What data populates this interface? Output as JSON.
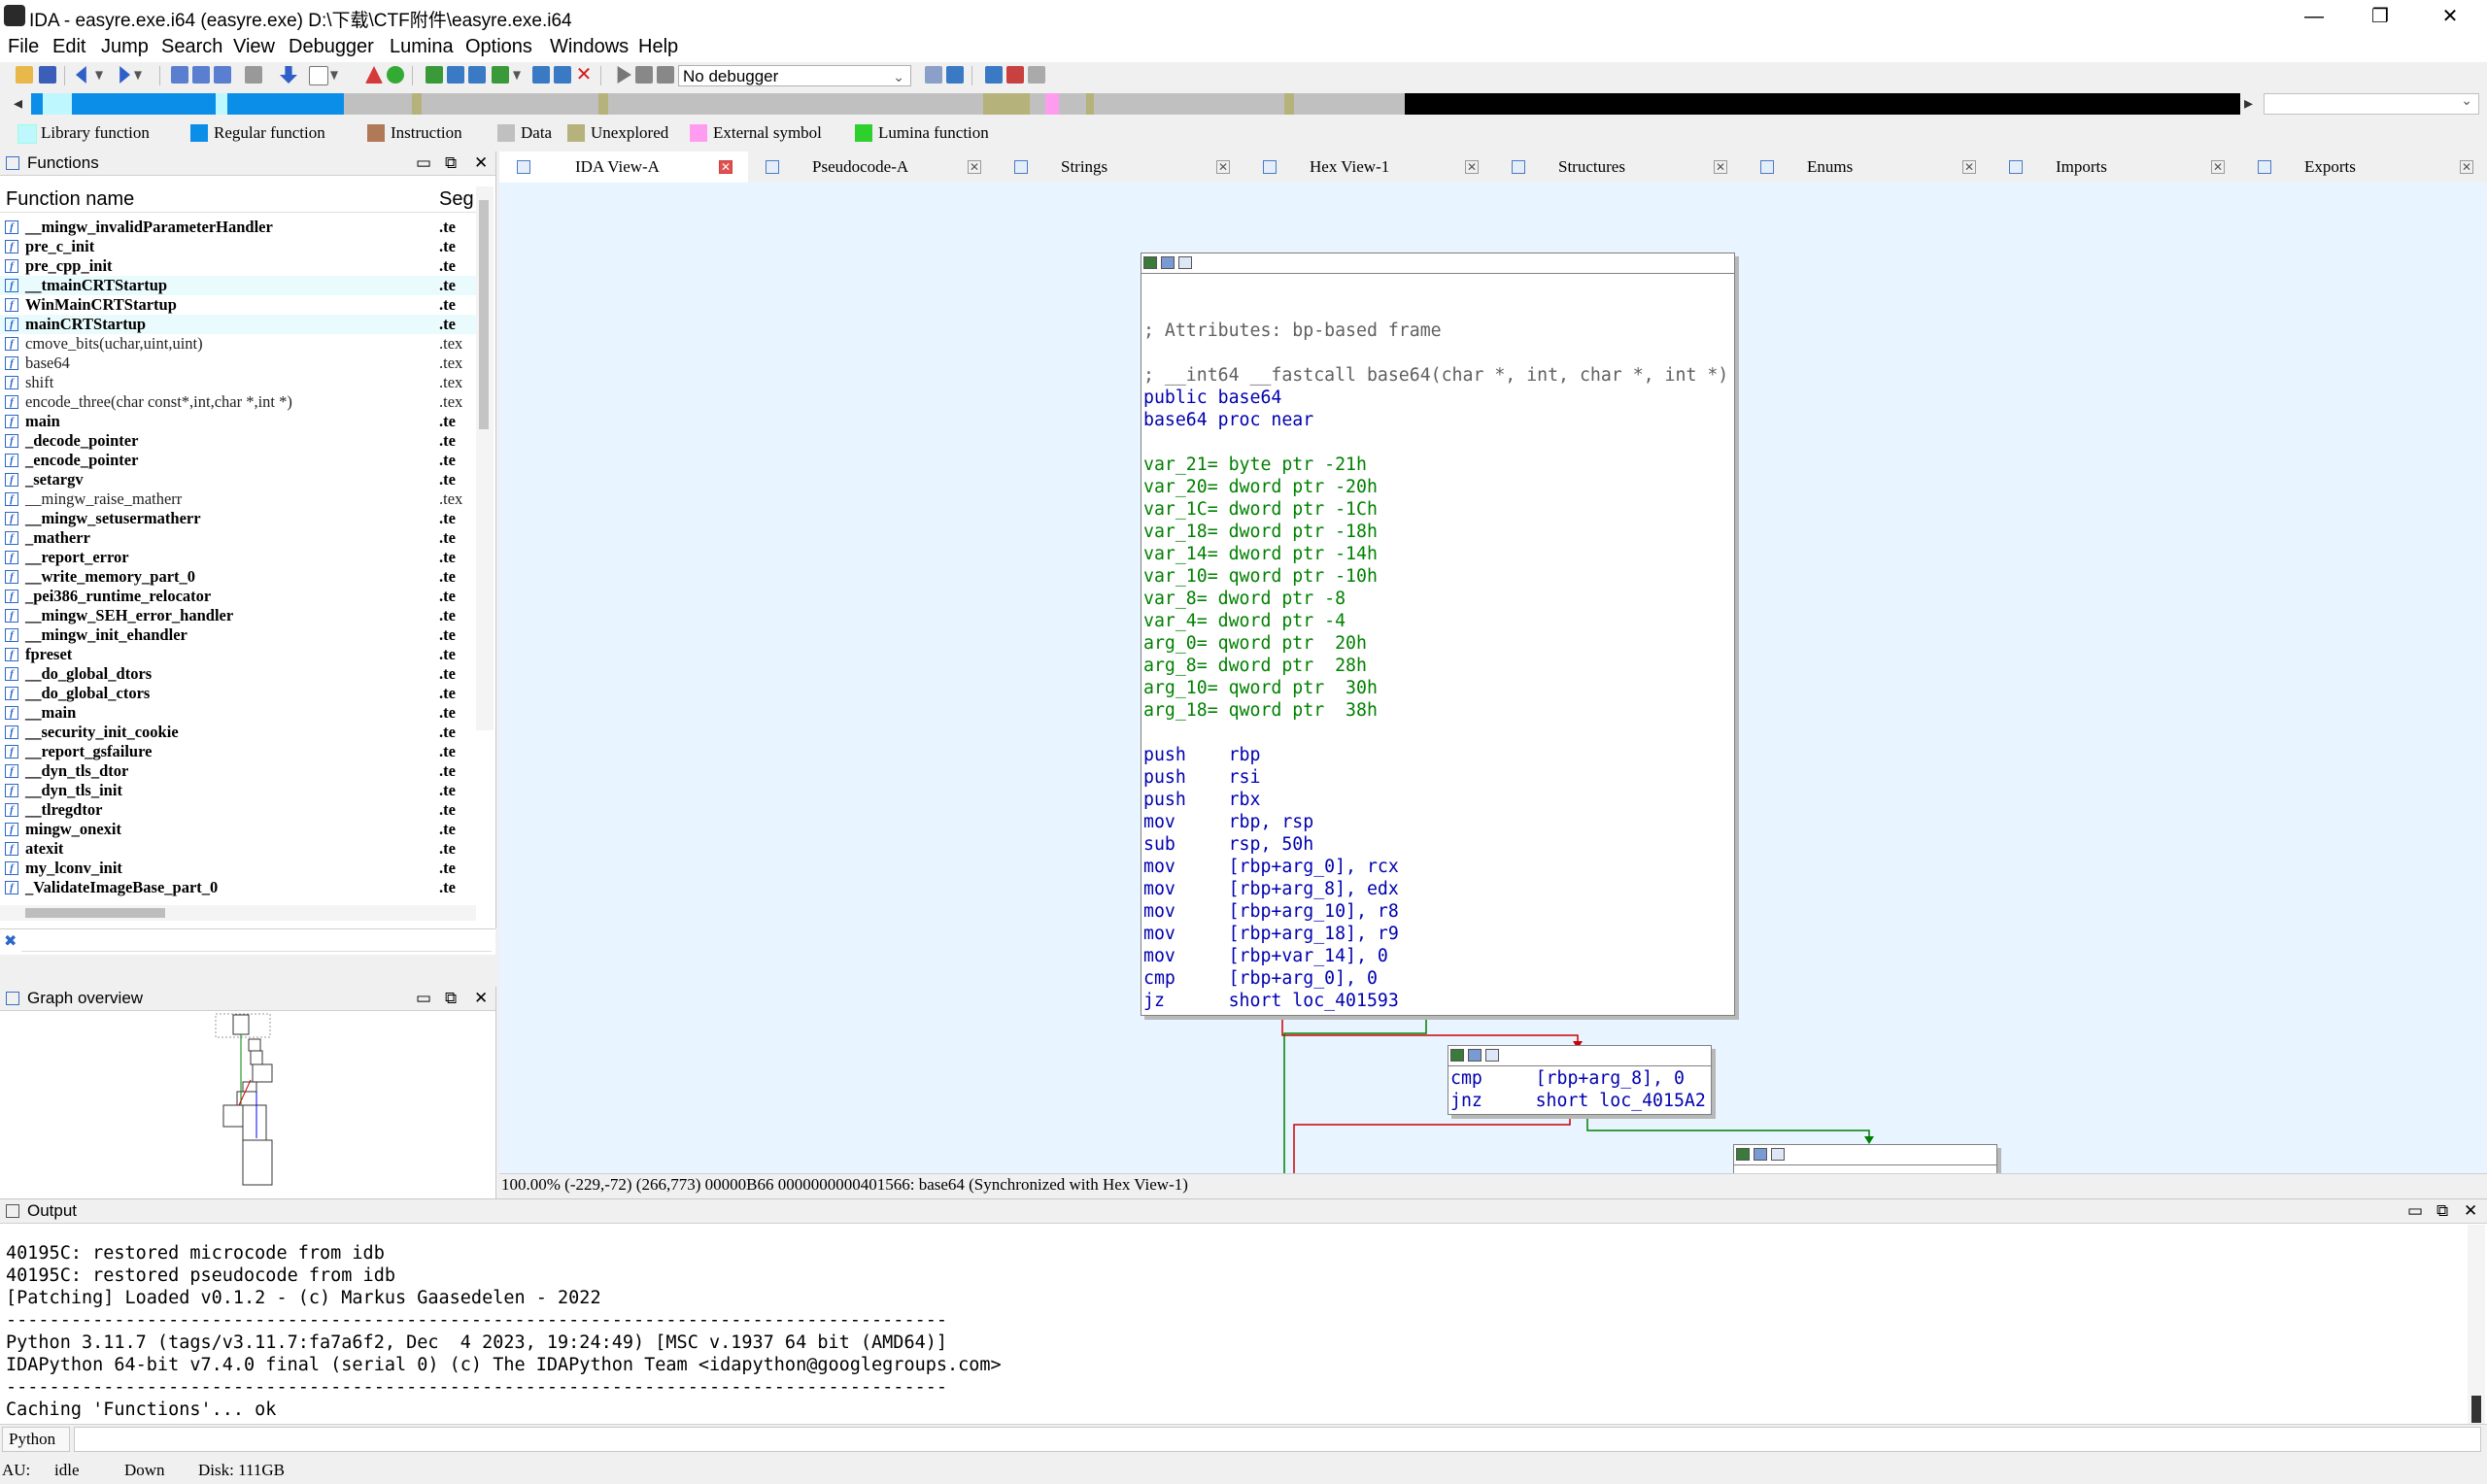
{
  "window": {
    "title": "IDA - easyre.exe.i64 (easyre.exe) D:\\下载\\CTF附件\\easyre.exe.i64",
    "minimize": "—",
    "maximize": "❐",
    "close": "✕"
  },
  "menu": [
    "File",
    "Edit",
    "Jump",
    "Search",
    "View",
    "Debugger",
    "Lumina",
    "Options",
    "Windows",
    "Help"
  ],
  "toolbar": {
    "debugger_select": "No debugger"
  },
  "legend": [
    {
      "label": "Library function",
      "color": "#bff7ff"
    },
    {
      "label": "Regular function",
      "color": "#0b8ee8"
    },
    {
      "label": "Instruction",
      "color": "#b07a58"
    },
    {
      "label": "Data",
      "color": "#c0c0c0"
    },
    {
      "label": "Unexplored",
      "color": "#b5b27c"
    },
    {
      "label": "External symbol",
      "color": "#ff9cf0"
    },
    {
      "label": "Lumina function",
      "color": "#2ed02e"
    }
  ],
  "functions_panel": {
    "title": "Functions",
    "col_name": "Function name",
    "col_seg": "Seg",
    "rows": [
      {
        "name": "__mingw_invalidParameterHandler",
        "seg": ".te",
        "bold": true
      },
      {
        "name": "pre_c_init",
        "seg": ".te",
        "bold": true
      },
      {
        "name": "pre_cpp_init",
        "seg": ".te",
        "bold": true
      },
      {
        "name": "__tmainCRTStartup",
        "seg": ".te",
        "bold": true
      },
      {
        "name": "WinMainCRTStartup",
        "seg": ".te",
        "bold": true
      },
      {
        "name": "mainCRTStartup",
        "seg": ".te",
        "bold": true
      },
      {
        "name": "cmove_bits(uchar,uint,uint)",
        "seg": ".tex",
        "bold": false
      },
      {
        "name": "base64",
        "seg": ".tex",
        "bold": false
      },
      {
        "name": "shift",
        "seg": ".tex",
        "bold": false
      },
      {
        "name": "encode_three(char const*,int,char *,int *)",
        "seg": ".tex",
        "bold": false
      },
      {
        "name": "main",
        "seg": ".te",
        "bold": true
      },
      {
        "name": "_decode_pointer",
        "seg": ".te",
        "bold": true
      },
      {
        "name": "_encode_pointer",
        "seg": ".te",
        "bold": true
      },
      {
        "name": "_setargv",
        "seg": ".te",
        "bold": true
      },
      {
        "name": "__mingw_raise_matherr",
        "seg": ".tex",
        "bold": false
      },
      {
        "name": "__mingw_setusermatherr",
        "seg": ".te",
        "bold": true
      },
      {
        "name": "_matherr",
        "seg": ".te",
        "bold": true
      },
      {
        "name": "__report_error",
        "seg": ".te",
        "bold": true
      },
      {
        "name": "__write_memory_part_0",
        "seg": ".te",
        "bold": true
      },
      {
        "name": "_pei386_runtime_relocator",
        "seg": ".te",
        "bold": true
      },
      {
        "name": "__mingw_SEH_error_handler",
        "seg": ".te",
        "bold": true
      },
      {
        "name": "__mingw_init_ehandler",
        "seg": ".te",
        "bold": true
      },
      {
        "name": "fpreset",
        "seg": ".te",
        "bold": true
      },
      {
        "name": "__do_global_dtors",
        "seg": ".te",
        "bold": true
      },
      {
        "name": "__do_global_ctors",
        "seg": ".te",
        "bold": true
      },
      {
        "name": "__main",
        "seg": ".te",
        "bold": true
      },
      {
        "name": "__security_init_cookie",
        "seg": ".te",
        "bold": true
      },
      {
        "name": "__report_gsfailure",
        "seg": ".te",
        "bold": true
      },
      {
        "name": "__dyn_tls_dtor",
        "seg": ".te",
        "bold": true
      },
      {
        "name": "__dyn_tls_init",
        "seg": ".te",
        "bold": true
      },
      {
        "name": "__tlregdtor",
        "seg": ".te",
        "bold": true
      },
      {
        "name": "mingw_onexit",
        "seg": ".te",
        "bold": true
      },
      {
        "name": "atexit",
        "seg": ".te",
        "bold": true
      },
      {
        "name": "my_lconv_init",
        "seg": ".te",
        "bold": true
      },
      {
        "name": "_ValidateImageBase_part_0",
        "seg": ".te",
        "bold": true
      }
    ]
  },
  "graph_overview": {
    "title": "Graph overview"
  },
  "tabs": [
    {
      "label": "IDA View-A",
      "active": true
    },
    {
      "label": "Pseudocode-A",
      "active": false
    },
    {
      "label": "Strings",
      "active": false
    },
    {
      "label": "Hex View-1",
      "active": false
    },
    {
      "label": "Structures",
      "active": false
    },
    {
      "label": "Enums",
      "active": false
    },
    {
      "label": "Imports",
      "active": false
    },
    {
      "label": "Exports",
      "active": false
    }
  ],
  "graph": {
    "main_node": [
      {
        "t": "",
        "c": "c-black"
      },
      {
        "t": "",
        "c": "c-black"
      },
      {
        "t": "; Attributes: bp-based frame",
        "c": "c-comment"
      },
      {
        "t": "",
        "c": "c-black"
      },
      {
        "t": "; __int64 __fastcall base64(char *, int, char *, int *)",
        "c": "c-comment"
      },
      {
        "t": "public base64",
        "c": "c-blue"
      },
      {
        "t": "base64 proc near",
        "c": "c-blue"
      },
      {
        "t": "",
        "c": "c-black"
      },
      {
        "t": "var_21= byte ptr -21h",
        "c": "c-green"
      },
      {
        "t": "var_20= dword ptr -20h",
        "c": "c-green"
      },
      {
        "t": "var_1C= dword ptr -1Ch",
        "c": "c-green"
      },
      {
        "t": "var_18= dword ptr -18h",
        "c": "c-green"
      },
      {
        "t": "var_14= dword ptr -14h",
        "c": "c-green"
      },
      {
        "t": "var_10= qword ptr -10h",
        "c": "c-green"
      },
      {
        "t": "var_8= dword ptr -8",
        "c": "c-green"
      },
      {
        "t": "var_4= dword ptr -4",
        "c": "c-green"
      },
      {
        "t": "arg_0= qword ptr  20h",
        "c": "c-green"
      },
      {
        "t": "arg_8= dword ptr  28h",
        "c": "c-green"
      },
      {
        "t": "arg_10= qword ptr  30h",
        "c": "c-green"
      },
      {
        "t": "arg_18= qword ptr  38h",
        "c": "c-green"
      },
      {
        "t": "",
        "c": "c-black"
      },
      {
        "t": "push    rbp",
        "c": "c-blue"
      },
      {
        "t": "push    rsi",
        "c": "c-blue"
      },
      {
        "t": "push    rbx",
        "c": "c-blue"
      },
      {
        "t": "mov     rbp, rsp",
        "c": "c-blue"
      },
      {
        "t": "sub     rsp, 50h",
        "c": "c-blue"
      },
      {
        "t": "mov     [rbp+arg_0], rcx",
        "c": "c-blue"
      },
      {
        "t": "mov     [rbp+arg_8], edx",
        "c": "c-blue"
      },
      {
        "t": "mov     [rbp+arg_10], r8",
        "c": "c-blue"
      },
      {
        "t": "mov     [rbp+arg_18], r9",
        "c": "c-blue"
      },
      {
        "t": "mov     [rbp+var_14], 0",
        "c": "c-blue"
      },
      {
        "t": "cmp     [rbp+arg_0], 0",
        "c": "c-blue"
      },
      {
        "t": "jz      short loc_401593",
        "c": "c-blue"
      }
    ],
    "node2": [
      {
        "t": "cmp     [rbp+arg_8], 0",
        "c": "c-blue"
      },
      {
        "t": "jnz     short loc_4015A2",
        "c": "c-blue"
      }
    ]
  },
  "status_line": "100.00% (-229,-72) (266,773) 00000B66 0000000000401566: base64 (Synchronized with Hex View-1)",
  "output": {
    "title": "Output",
    "lines": [
      "40195C: restored microcode from idb",
      "40195C: restored pseudocode from idb",
      "[Patching] Loaded v0.1.2 - (c) Markus Gaasedelen - 2022",
      "---------------------------------------------------------------------------------------",
      "Python 3.11.7 (tags/v3.11.7:fa7a6f2, Dec  4 2023, 19:24:49) [MSC v.1937 64 bit (AMD64)]",
      "IDAPython 64-bit v7.4.0 final (serial 0) (c) The IDAPython Team <idapython@googlegroups.com>",
      "---------------------------------------------------------------------------------------",
      "Caching 'Functions'... ok"
    ]
  },
  "python_label": "Python",
  "statusbar": {
    "au": "AU:",
    "state": "idle",
    "dir": "Down",
    "disk": "Disk: 111GB"
  }
}
